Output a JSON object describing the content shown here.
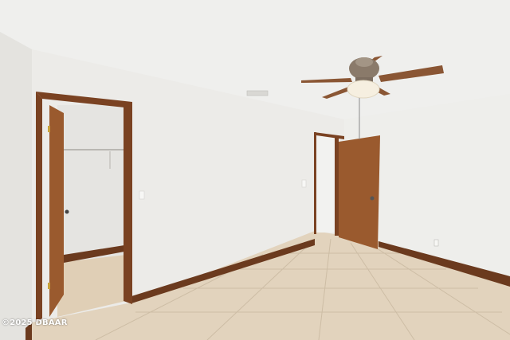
{
  "photo": {
    "watermark": "©2025 DBAAR",
    "colors": {
      "ceiling": "#efefed",
      "wall": "#ecebe8",
      "wall_shadow": "#e2e1dd",
      "trim": "#6b3a1e",
      "door": "#9a5a2e",
      "floor": "#e2d3bd",
      "floor_grout": "#cdbda5",
      "fan_blade": "#8a5634",
      "fan_light": "#f6efe0"
    }
  }
}
